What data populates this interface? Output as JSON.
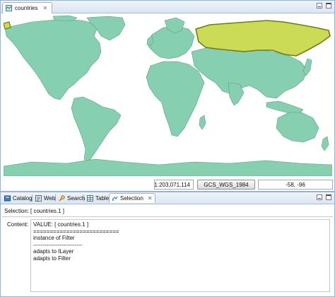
{
  "editor": {
    "tab_title": "countries",
    "tab_icon": "map-icon"
  },
  "statusbar": {
    "scale": "1:203,071,114",
    "crs": "GCS_WGS_1984",
    "coordinates": "-58, -96"
  },
  "views": {
    "tabs": [
      {
        "label": "Catalog",
        "icon": "catalog-icon"
      },
      {
        "label": "Web",
        "icon": "web-icon"
      },
      {
        "label": "Search",
        "icon": "search-icon"
      },
      {
        "label": "Table",
        "icon": "table-icon"
      },
      {
        "label": "Selection",
        "icon": "selection-icon",
        "active": true
      }
    ],
    "selection_label": "Selection:",
    "selection_value": "[ countries.1 ]",
    "content_label": "Content:",
    "content_lines": [
      "VALUE: [ countries.1 ]",
      "==========================",
      "instance of Filter",
      "--------------------------",
      "adapts to ILayer",
      "adapts to Filter"
    ]
  },
  "colors": {
    "land": "#86cfb0",
    "land_border": "#5d9d84",
    "selected_fill": "#ccdb55",
    "selected_border": "#6f7d12",
    "panel_border": "#99b4d1"
  }
}
